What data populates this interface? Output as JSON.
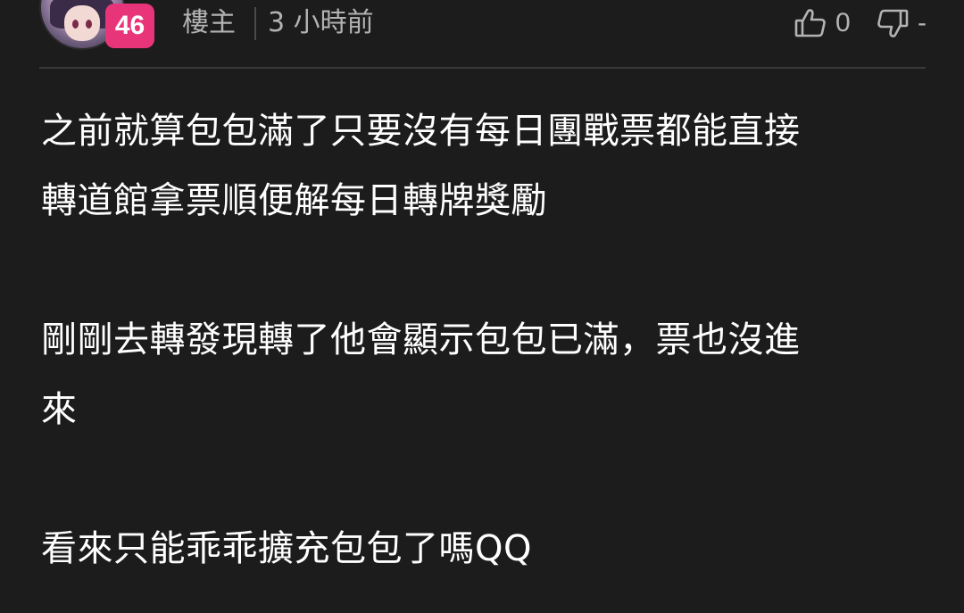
{
  "post": {
    "level": "46",
    "author_tag": "樓主",
    "time": "3 小時前",
    "like_count": "0",
    "dislike_count": "-",
    "paragraphs": [
      [
        "之前就算包包滿了只要沒有每日團戰票都能直接",
        "轉道館拿票順便解每日轉牌獎勵"
      ],
      [
        "剛剛去轉發現轉了他會顯示包包已滿，票也沒進",
        "來"
      ],
      [
        "看來只能乖乖擴充包包了嗎QQ"
      ]
    ]
  },
  "icons": {
    "like": "thumbs-up-icon",
    "dislike": "thumbs-down-icon"
  },
  "colors": {
    "background": "#1c1c1d",
    "badge": "#e8357a",
    "muted_text": "#b3b3b3",
    "divider": "#3a3a3c"
  }
}
